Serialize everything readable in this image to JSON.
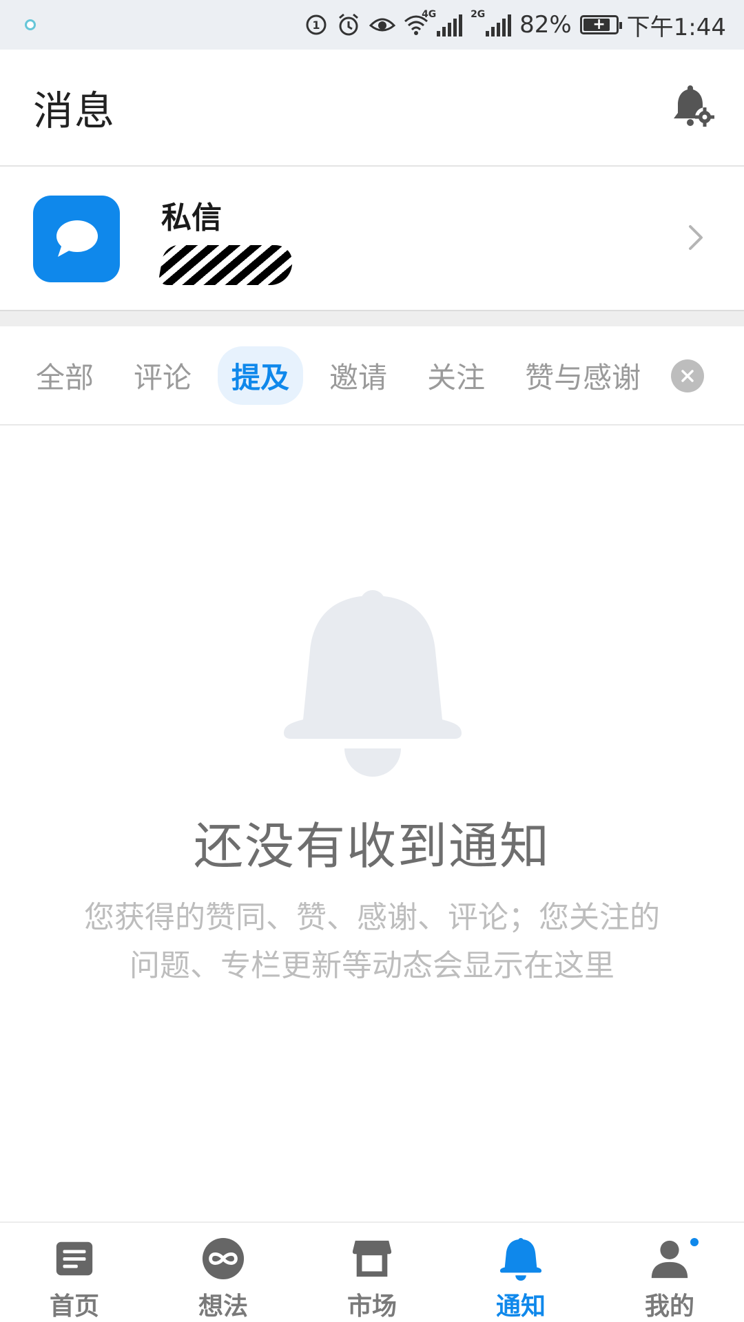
{
  "status_bar": {
    "battery_percent": "82%",
    "time": "下午1:44",
    "network_labels": [
      "4G",
      "2G"
    ],
    "icons": [
      "notification-dot-icon",
      "data-saver-icon",
      "alarm-icon",
      "eye-care-icon",
      "wifi-icon",
      "signal-4g-icon",
      "signal-2g-icon",
      "battery-icon"
    ]
  },
  "header": {
    "title": "消息",
    "settings_icon": "bell-settings-icon"
  },
  "private_message": {
    "title": "私信",
    "icon": "chat-bubble-icon"
  },
  "tabs": {
    "items": [
      {
        "label": "全部",
        "active": false
      },
      {
        "label": "评论",
        "active": false
      },
      {
        "label": "提及",
        "active": true
      },
      {
        "label": "邀请",
        "active": false
      },
      {
        "label": "关注",
        "active": false
      },
      {
        "label": "赞与感谢",
        "active": false
      }
    ]
  },
  "empty_state": {
    "title": "还没有收到通知",
    "description": "您获得的赞同、赞、感谢、评论；您关注的问题、专栏更新等动态会显示在这里"
  },
  "bottom_nav": {
    "items": [
      {
        "label": "首页",
        "icon": "home-feed-icon",
        "active": false
      },
      {
        "label": "想法",
        "icon": "ideas-icon",
        "active": false
      },
      {
        "label": "市场",
        "icon": "market-icon",
        "active": false
      },
      {
        "label": "通知",
        "icon": "notification-bell-icon",
        "active": true
      },
      {
        "label": "我的",
        "icon": "profile-icon",
        "active": false
      }
    ]
  },
  "colors": {
    "accent": "#0f88eb",
    "muted_text": "#bdbdbd",
    "empty_icon": "#e8ebf0"
  }
}
